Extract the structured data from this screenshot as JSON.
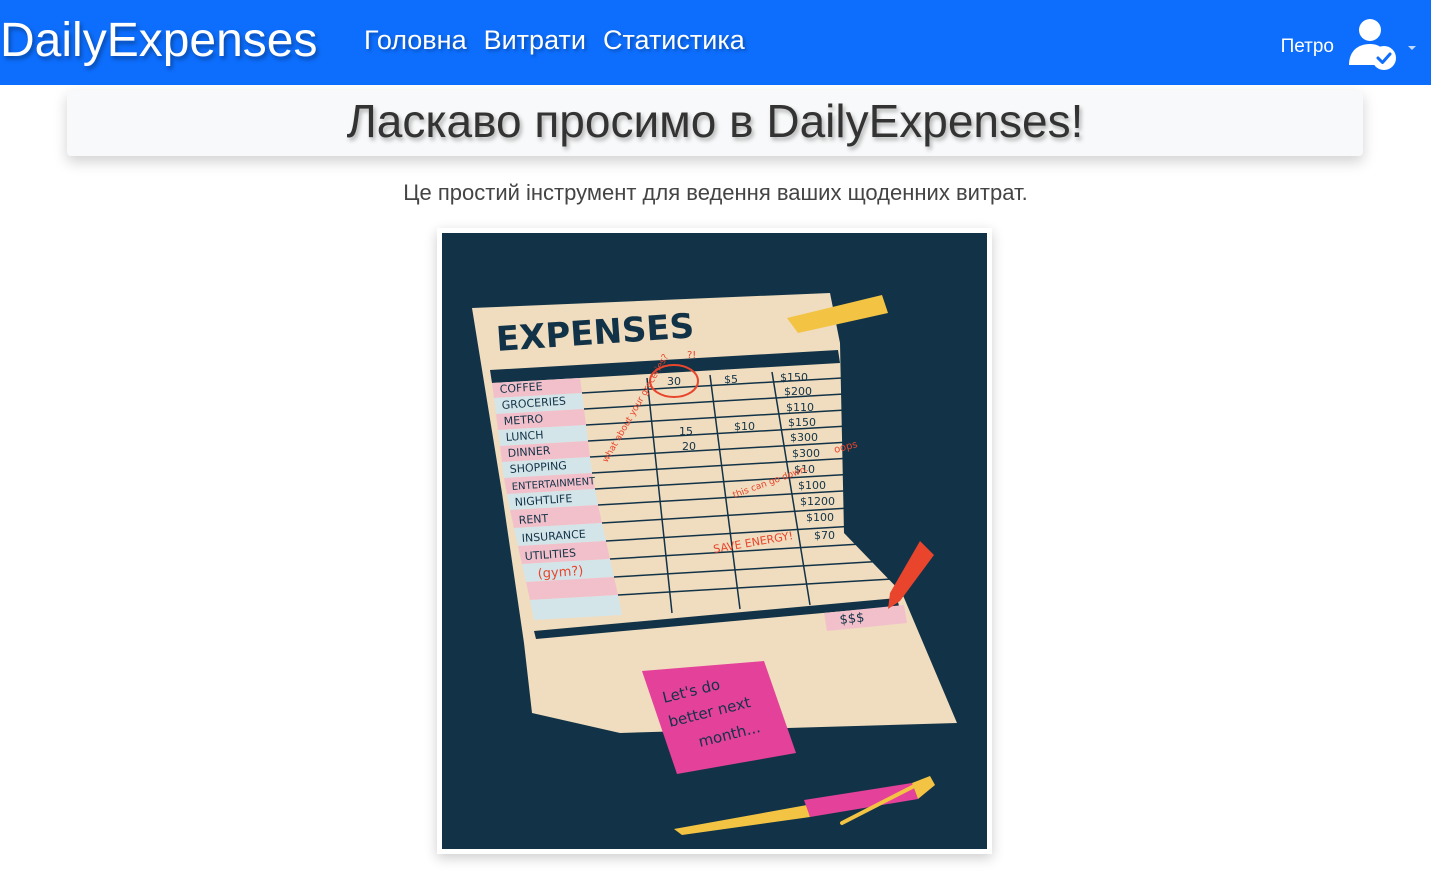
{
  "navbar": {
    "brand": "DailyExpenses",
    "links": [
      "Головна",
      "Витрати",
      "Статистика"
    ],
    "user_name": "Петро",
    "user_icon": "user-check-icon",
    "caret_icon": "caret-down-icon",
    "bg_color": "#0d6efd"
  },
  "hero": {
    "title": "Ласкаво просимо в DailyExpenses!"
  },
  "subtitle": "Це простий інструмент для ведення ваших щоденних витрат.",
  "illustration": {
    "heading": "EXPENSES",
    "categories": [
      "COFFEE",
      "GROCERIES",
      "METRO",
      "LUNCH",
      "DINNER",
      "SHOPPING",
      "ENTERTAINMENT",
      "NIGHTLIFE",
      "RENT",
      "INSURANCE",
      "UTILITIES",
      "(gym?)"
    ],
    "col2_values": [
      "30",
      "",
      "",
      "15",
      "20"
    ],
    "col3_values": [
      "$5",
      "",
      "",
      "$10"
    ],
    "col4_values": [
      "$150",
      "$200",
      "$110",
      "$150",
      "$300",
      "$300",
      "$10",
      "$100",
      "$1200",
      "$100",
      "$70"
    ],
    "notes": {
      "question": "?!",
      "groceries": "what about your groceries?",
      "oops": "oops",
      "cut": "this can go down.",
      "energy": "SAVE ENERGY!",
      "total": "$$$"
    },
    "sticky_note": [
      "Let's do",
      "better next",
      "month..."
    ],
    "colors": {
      "background": "#123347",
      "paper": "#f0dcbe",
      "pink": "#f2c0cb",
      "blue": "#d4e5ea",
      "red": "#e8452c",
      "yellow": "#f3c343",
      "magenta": "#e4419a"
    }
  }
}
